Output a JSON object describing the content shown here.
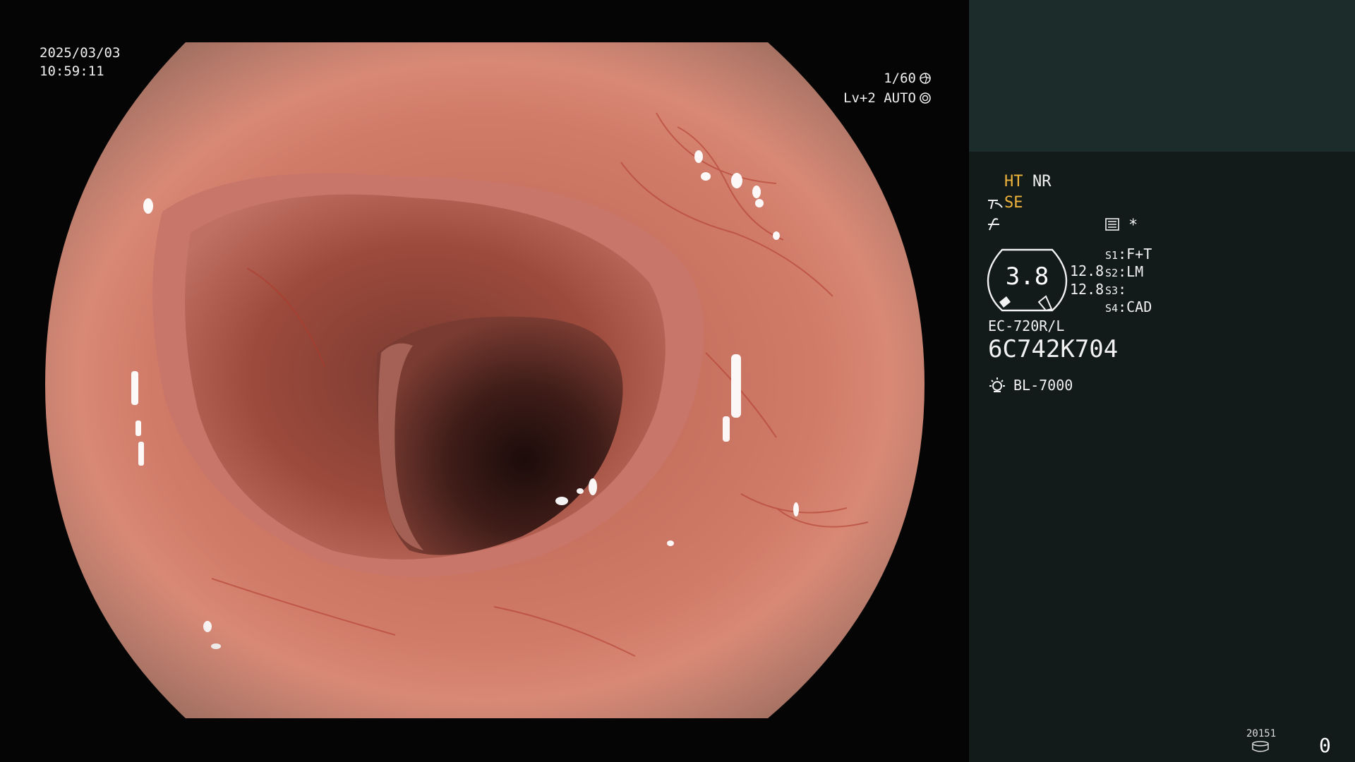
{
  "osd": {
    "date": "2025/03/03",
    "time": "10:59:11",
    "shutter": "1/60",
    "level": "Lv+2 AUTO"
  },
  "panel": {
    "enhancement_ht": "HT",
    "enhancement_nr": "NR",
    "mode_se": "SE",
    "asterisk": "*",
    "gauge_value": "3.8",
    "side_values": [
      "12.8",
      "12.8"
    ],
    "switches": [
      {
        "key": "S1",
        "value": "F+T"
      },
      {
        "key": "S2",
        "value": "LM"
      },
      {
        "key": "S3",
        "value": ""
      },
      {
        "key": "S4",
        "value": "CAD"
      }
    ],
    "scope_model": "EC-720R/L",
    "scope_serial": "6C742K704",
    "light_source": "BL-7000",
    "counter_small": "20151",
    "counter_big": "0"
  },
  "colors": {
    "panel_bg": "#121b19",
    "panel_top_bg": "#1b2c2a",
    "accent_yellow": "#f0b43c",
    "mucosa": "#c8705e"
  },
  "icons": [
    "shutter-icon",
    "auto-iris-icon",
    "scope-tip-icon",
    "signal-icon",
    "settings-list-icon",
    "gauge-icon",
    "light-source-icon",
    "disk-icon"
  ]
}
